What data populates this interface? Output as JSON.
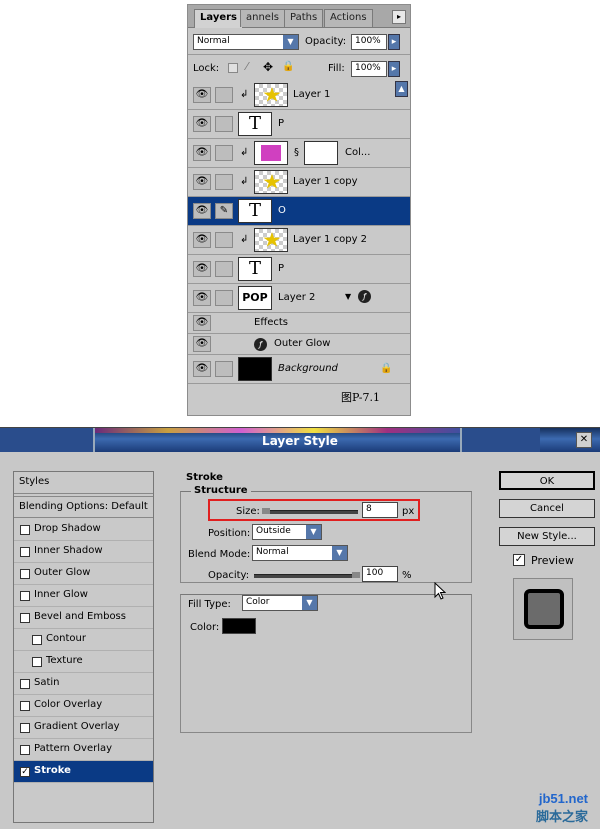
{
  "layers_panel": {
    "tabs": [
      "Layers",
      "Channels",
      "Paths",
      "Actions"
    ],
    "tab_display": [
      "Layers",
      "annels",
      "Paths",
      "Actions"
    ],
    "blend_mode": "Normal",
    "opacity_label": "Opacity:",
    "opacity_value": "100%",
    "lock_label": "Lock:",
    "fill_label": "Fill:",
    "fill_value": "100%",
    "layers": [
      {
        "name": "Layer 1",
        "type": "image"
      },
      {
        "name": "P",
        "type": "text"
      },
      {
        "name": "Col...",
        "type": "fill"
      },
      {
        "name": "Layer 1 copy",
        "type": "image"
      },
      {
        "name": "O",
        "type": "text",
        "selected": true
      },
      {
        "name": "Layer 1 copy 2",
        "type": "image"
      },
      {
        "name": "P",
        "type": "text"
      },
      {
        "name": "Layer 2",
        "type": "pop",
        "thumb_text": "POP"
      },
      {
        "name": "Background",
        "type": "background"
      }
    ],
    "effects_label": "Effects",
    "outer_glow_label": "Outer Glow",
    "figure_label": "图P-7.1"
  },
  "dialog": {
    "title": "Layer Style",
    "styles_header": "Styles",
    "blending_options": "Blending Options: Default",
    "style_items": [
      {
        "label": "Drop Shadow",
        "sub": false
      },
      {
        "label": "Inner Shadow",
        "sub": false
      },
      {
        "label": "Outer Glow",
        "sub": false
      },
      {
        "label": "Inner Glow",
        "sub": false
      },
      {
        "label": "Bevel and Emboss",
        "sub": false
      },
      {
        "label": "Contour",
        "sub": true
      },
      {
        "label": "Texture",
        "sub": true
      },
      {
        "label": "Satin",
        "sub": false
      },
      {
        "label": "Color Overlay",
        "sub": false
      },
      {
        "label": "Gradient Overlay",
        "sub": false
      },
      {
        "label": "Pattern Overlay",
        "sub": false
      },
      {
        "label": "Stroke",
        "sub": false,
        "active": true
      }
    ],
    "stroke": {
      "section_title": "Stroke",
      "structure_title": "Structure",
      "size_label": "Size:",
      "size_value": "8",
      "size_unit": "px",
      "position_label": "Position:",
      "position_value": "Outside",
      "blend_mode_label": "Blend Mode:",
      "blend_mode_value": "Normal",
      "opacity_label": "Opacity:",
      "opacity_value": "100",
      "opacity_unit": "%",
      "fill_type_label": "Fill Type:",
      "fill_type_value": "Color",
      "color_label": "Color:",
      "color_value": "#000000"
    },
    "buttons": {
      "ok": "OK",
      "cancel": "Cancel",
      "new_style": "New Style...",
      "preview": "Preview"
    }
  },
  "watermark": {
    "url": "jb51.net",
    "cn": "脚本之家"
  }
}
